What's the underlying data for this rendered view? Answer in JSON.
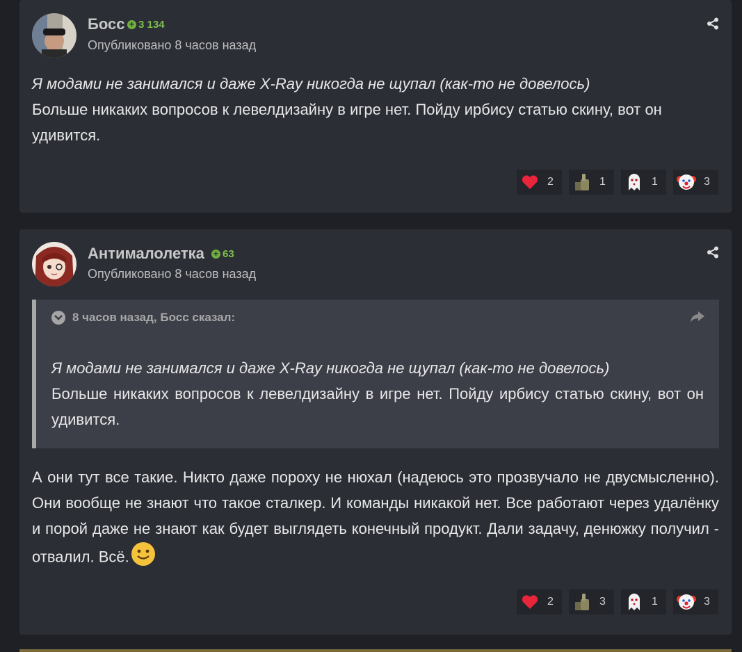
{
  "posts": [
    {
      "author": "Босс",
      "reputation": "3 134",
      "published": "Опубликовано 8 часов назад",
      "body": [
        {
          "text": "Я модами не занимался и даже X-Ray никогда не щупал (как-то не довелось)",
          "italic": true
        },
        {
          "text": "Больше никаких вопросов к левелдизайну в игре нет. Пойду ирбису статью скину, вот он удивится.",
          "italic": false
        }
      ],
      "reactions": [
        {
          "icon": "heart-icon",
          "count": "2"
        },
        {
          "icon": "thumbs-up-icon",
          "count": "1"
        },
        {
          "icon": "ghost-icon",
          "count": "1"
        },
        {
          "icon": "clown-icon",
          "count": "3"
        }
      ]
    },
    {
      "author": "Антималолетка",
      "reputation": "63",
      "published": "Опубликовано 8 часов назад",
      "quote": {
        "header": "8 часов назад, Босс сказал:",
        "lines": [
          {
            "text": "Я модами не занимался и даже X-Ray никогда не щупал (как-то не довелось)",
            "italic": true
          },
          {
            "text": "Больше никаких вопросов к левелдизайну в игре нет. Пойду ирбису статью скину, вот он удивится.",
            "italic": false
          }
        ]
      },
      "body": "А они тут все такие. Никто даже пороху не нюхал (надеюсь это прозвучало не двусмысленно). Они вообще не знают что такое сталкер. И команды никакой нет. Все работают через удалёнку и порой даже не знают как будет выглядеть конечный продукт. Дали задачу, денюжку получил - отвалил. Всё.",
      "reactions": [
        {
          "icon": "heart-icon",
          "count": "2"
        },
        {
          "icon": "thumbs-up-icon",
          "count": "3"
        },
        {
          "icon": "ghost-icon",
          "count": "1"
        },
        {
          "icon": "clown-icon",
          "count": "3"
        }
      ]
    }
  ],
  "colors": {
    "background": "#1f2026",
    "post": "#2c2e36",
    "rep": "#7fbf4d",
    "quote_bg": "#3c3e48"
  }
}
